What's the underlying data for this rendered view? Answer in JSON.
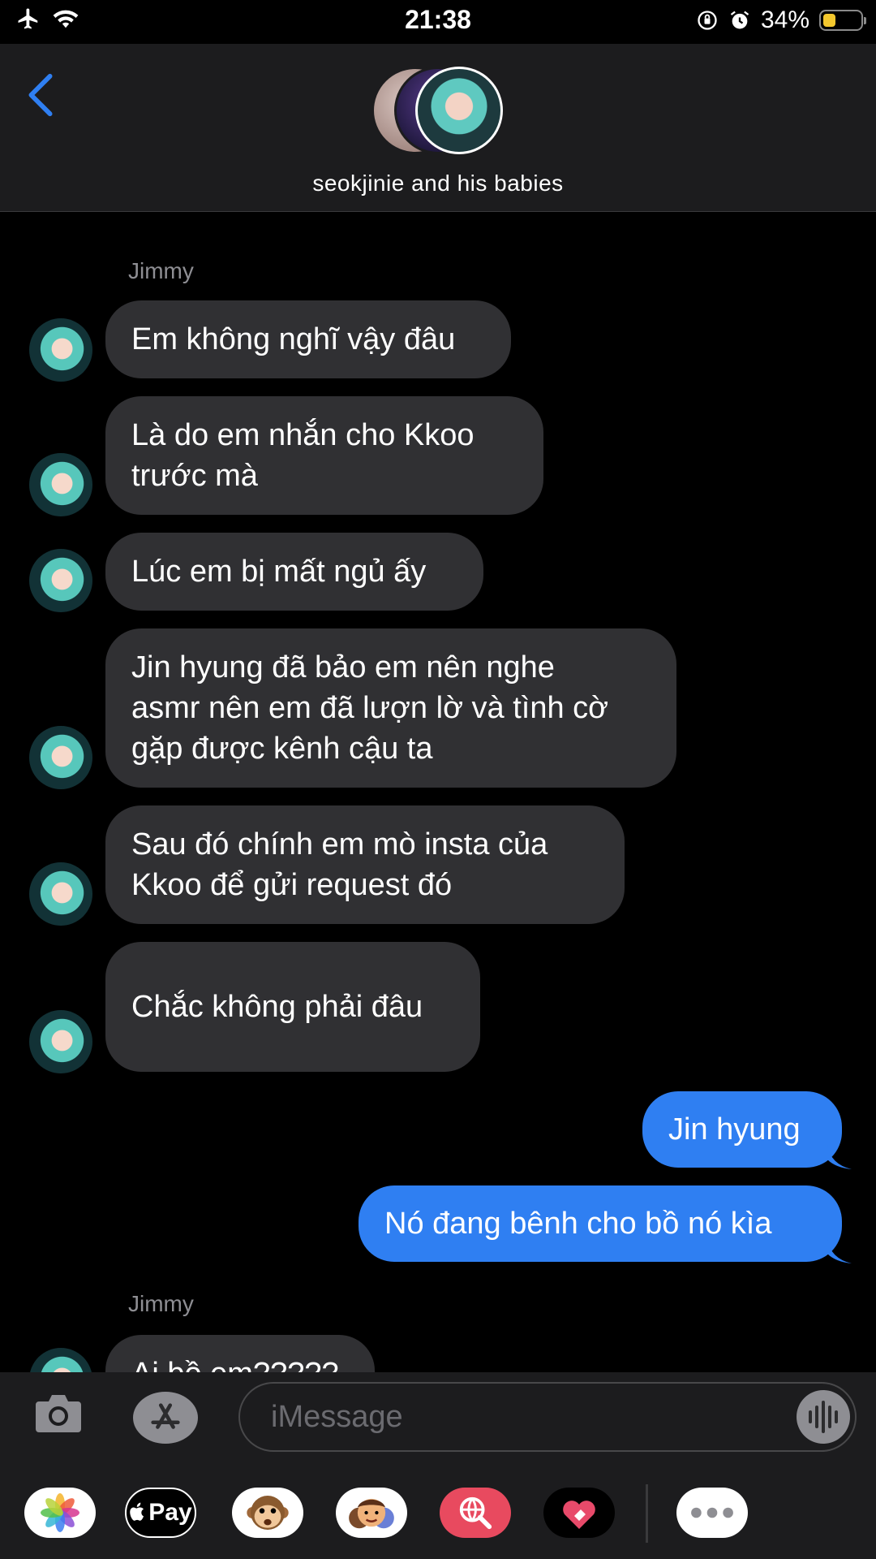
{
  "status_bar": {
    "time": "21:38",
    "battery_percent": "34%",
    "battery_level": 0.34
  },
  "header": {
    "group_name": "seokjinie and his babies"
  },
  "messages": [
    {
      "sender": "Jimmy"
    },
    {
      "text": "Em không nghĩ vậy đâu"
    },
    {
      "text": "Là do em nhắn cho Kkoo\ntrước mà"
    },
    {
      "text": "Lúc em bị mất ngủ ấy"
    },
    {
      "text": "Jin hyung đã bảo em nên nghe\nasmr nên em đã lượn lờ và tình cờ\ngặp được kênh cậu ta"
    },
    {
      "text": "Sau đó chính em mò insta của\nKkoo để gửi request đó"
    },
    {
      "text": "Chắc không phải đâu"
    },
    {
      "text": "Jin hyung"
    },
    {
      "text": "Nó đang bênh cho bồ nó kìa"
    },
    {
      "sender": "Jimmy"
    },
    {
      "text": "Ai bồ em?????"
    }
  ],
  "input": {
    "placeholder": "iMessage"
  },
  "app_drawer": [
    {
      "icon": "photos-app-icon"
    },
    {
      "icon": "apple-pay-icon",
      "label": "Pay"
    },
    {
      "icon": "animoji-monkey-icon"
    },
    {
      "icon": "memoji-icon"
    },
    {
      "icon": "web-search-icon"
    },
    {
      "icon": "digital-touch-icon"
    },
    {
      "icon": "more-apps-icon"
    }
  ],
  "colors": {
    "sent_bubble": "#2f7ff2",
    "received_bubble": "#303033",
    "back_arrow": "#2f7ff2"
  }
}
